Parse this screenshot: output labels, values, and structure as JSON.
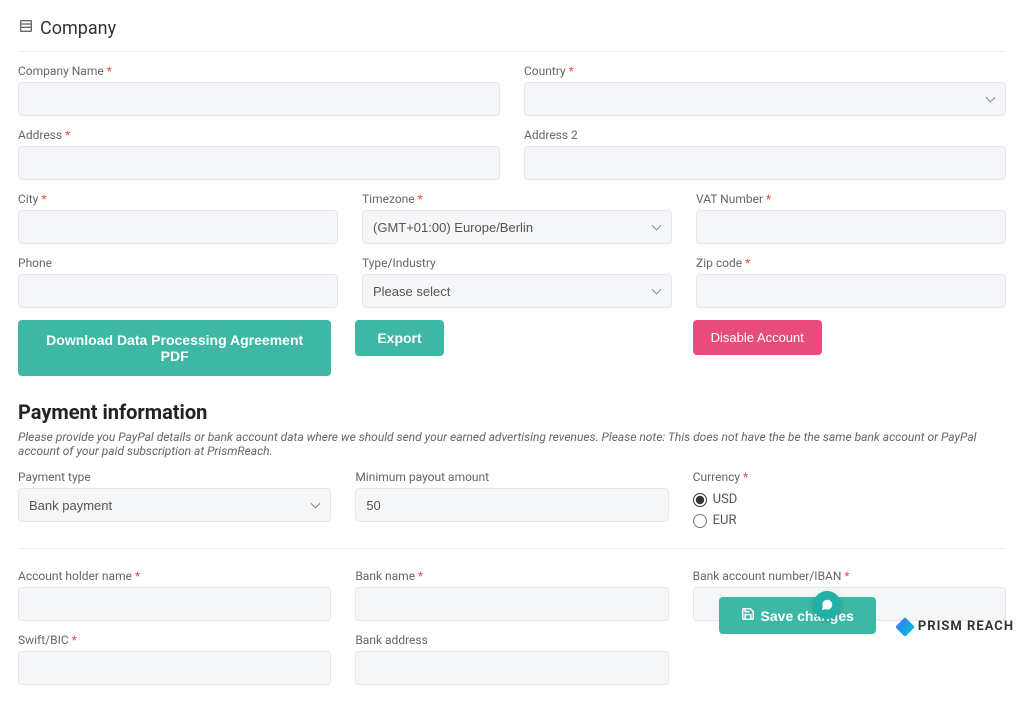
{
  "company": {
    "header": "Company",
    "company_name_label": "Company Name",
    "country_label": "Country",
    "address_label": "Address",
    "address2_label": "Address 2",
    "city_label": "City",
    "timezone_label": "Timezone",
    "timezone_value": "(GMT+01:00) Europe/Berlin",
    "vat_label": "VAT Number",
    "phone_label": "Phone",
    "type_label": "Type/Industry",
    "type_value": "Please select",
    "zip_label": "Zip code",
    "buttons": {
      "download": "Download Data Processing Agreement PDF",
      "export": "Export",
      "disable": "Disable Account"
    }
  },
  "payment": {
    "title": "Payment information",
    "helper": "Please provide you PayPal details or bank account data where we should send your earned advertising revenues. Please note: This does not have the be the same bank account or PayPal account of your paid subscription at PrismReach.",
    "payment_type_label": "Payment type",
    "payment_type_value": "Bank payment",
    "min_payout_label": "Minimum payout amount",
    "min_payout_value": "50",
    "currency_label": "Currency",
    "currency_options": {
      "usd": "USD",
      "eur": "EUR"
    },
    "currency_selected": "USD",
    "holder_label": "Account holder name",
    "bank_name_label": "Bank name",
    "iban_label": "Bank account number/IBAN",
    "swift_label": "Swift/BIC",
    "bank_address_label": "Bank address"
  },
  "footer": {
    "save": "Save changes",
    "brand": "PRISM REACH"
  }
}
